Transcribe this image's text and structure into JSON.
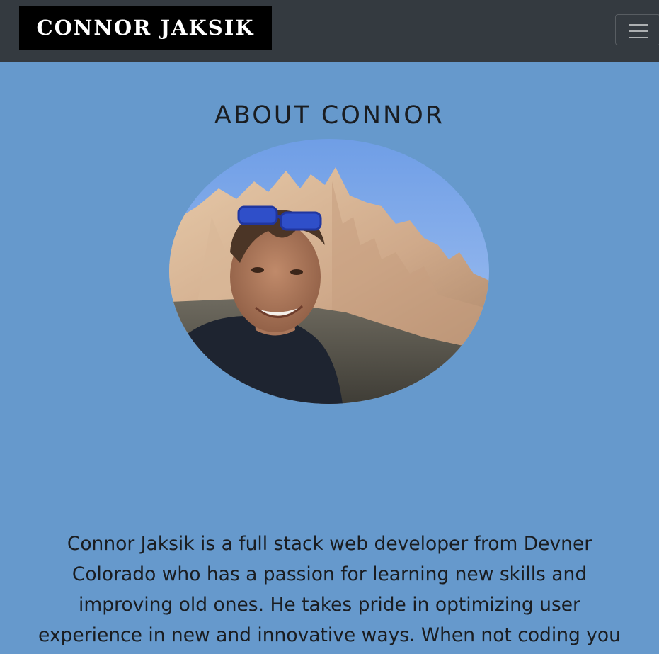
{
  "navbar": {
    "brand": "CONNOR JAKSIK",
    "toggler_icon": "hamburger-menu-icon"
  },
  "about": {
    "heading": "ABOUT CONNOR",
    "bio_lines": [
      "Connor Jaksik is a full stack web developer from Devner",
      "Colorado who has a passion for learning new skills and",
      "improving old ones. He takes pride in optimizing user",
      "experience in new and innovative ways. When not coding you"
    ]
  },
  "colors": {
    "background": "#6699cc",
    "navbar": "#343a40",
    "brand_bg": "#000000"
  }
}
